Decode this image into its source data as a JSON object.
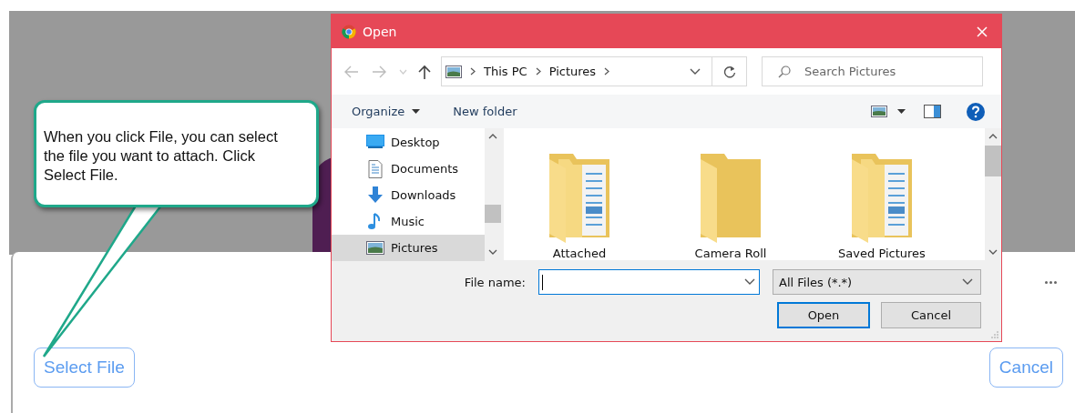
{
  "callout": {
    "text": "When you click File, you can select the file you want to attach. Click Select File."
  },
  "dialog": {
    "title": "Open",
    "breadcrumbs": [
      "This PC",
      "Pictures"
    ],
    "search": {
      "placeholder": "Search Pictures"
    },
    "toolbar": [
      "Organize",
      "New folder"
    ],
    "nav_items": [
      {
        "label": "Desktop",
        "kind": "desktop",
        "selected": false
      },
      {
        "label": "Documents",
        "kind": "document",
        "selected": false
      },
      {
        "label": "Downloads",
        "kind": "download",
        "selected": false
      },
      {
        "label": "Music",
        "kind": "music",
        "selected": false
      },
      {
        "label": "Pictures",
        "kind": "pictures",
        "selected": true
      }
    ],
    "folders": [
      {
        "label": "Attached",
        "kind": "filled"
      },
      {
        "label": "Camera Roll",
        "kind": "empty"
      },
      {
        "label": "Saved Pictures",
        "kind": "filled"
      }
    ],
    "file_name": {
      "label": "File name:"
    },
    "file_type": "All Files (*.*)",
    "buttons": [
      {
        "label": "Open",
        "kind": "default"
      },
      {
        "label": "Cancel",
        "kind": "normal"
      }
    ]
  },
  "page": {
    "select_button": "Select File",
    "cancel_button": "Cancel"
  }
}
